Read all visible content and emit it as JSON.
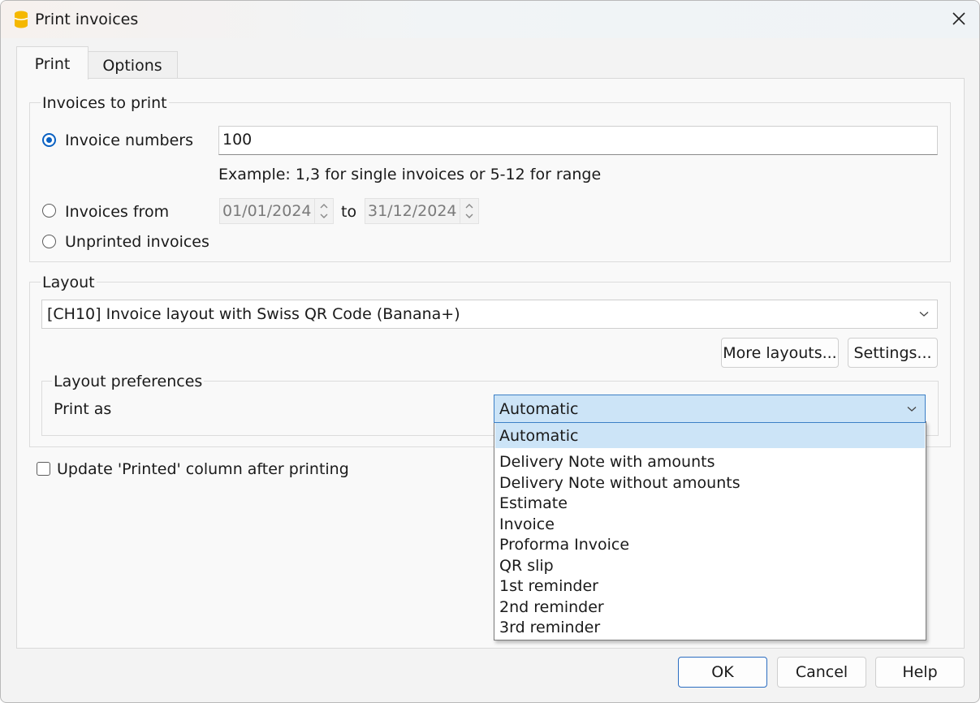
{
  "window": {
    "title": "Print invoices"
  },
  "tabs": [
    {
      "label": "Print",
      "active": true
    },
    {
      "label": "Options",
      "active": false
    }
  ],
  "invoices_to_print": {
    "group_title": "Invoices to print",
    "invoice_numbers": {
      "label": "Invoice numbers",
      "checked": true,
      "value": "100"
    },
    "example_text": "Example: 1,3 for single invoices or 5-12 for range",
    "invoices_from": {
      "label": "Invoices from",
      "checked": false,
      "from_value": "01/01/2024",
      "to_label": "to",
      "to_value": "31/12/2024"
    },
    "unprinted": {
      "label": "Unprinted invoices",
      "checked": false
    }
  },
  "layout": {
    "group_title": "Layout",
    "selected_layout": "[CH10] Invoice layout with Swiss QR Code (Banana+)",
    "more_layouts_label": "More layouts...",
    "settings_label": "Settings...",
    "preferences": {
      "group_title": "Layout preferences",
      "print_as_label": "Print as",
      "print_as_value": "Automatic",
      "options": [
        "Automatic",
        "Delivery Note with amounts",
        "Delivery Note without amounts",
        "Estimate",
        "Invoice",
        "Proforma Invoice",
        "QR slip",
        "1st reminder",
        "2nd reminder",
        "3rd reminder"
      ],
      "highlighted_index": 0
    }
  },
  "update_printed": {
    "label": "Update 'Printed' column after printing",
    "checked": false
  },
  "footer": {
    "ok_label": "OK",
    "cancel_label": "Cancel",
    "help_label": "Help"
  },
  "colors": {
    "accent": "#0a61c2",
    "selection": "#cce4f7",
    "app_icon": "#f5b800"
  },
  "icons": [
    "banana-app-icon",
    "close-icon",
    "radio-icon",
    "spin-up-icon",
    "spin-down-icon",
    "chevron-down-icon",
    "checkbox-icon"
  ]
}
